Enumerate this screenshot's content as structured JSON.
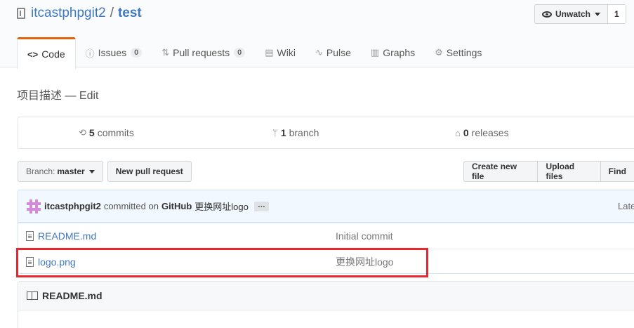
{
  "repo": {
    "owner": "itcastphpgit2",
    "separator": "/",
    "name": "test"
  },
  "watch": {
    "label": "Unwatch",
    "count": "1"
  },
  "tabs": [
    {
      "icon": "<>",
      "label": "Code"
    },
    {
      "icon": "ⓘ",
      "label": "Issues",
      "count": "0"
    },
    {
      "icon": "⇅",
      "label": "Pull requests",
      "count": "0"
    },
    {
      "icon": "▤",
      "label": "Wiki"
    },
    {
      "icon": "∿",
      "label": "Pulse"
    },
    {
      "icon": "▥",
      "label": "Graphs"
    },
    {
      "icon": "⚙",
      "label": "Settings"
    }
  ],
  "description": "项目描述 — Edit",
  "stats": {
    "commits": {
      "count": "5",
      "label": "commits"
    },
    "branches": {
      "count": "1",
      "label": "branch"
    },
    "releases": {
      "count": "0",
      "label": "releases"
    }
  },
  "toolbar": {
    "branch_prefix": "Branch:",
    "branch_name": "master",
    "new_pr": "New pull request",
    "create_file": "Create new file",
    "upload_files": "Upload files",
    "find": "Find"
  },
  "commit": {
    "author": "itcastphpgit2",
    "action": "committed on",
    "platform": "GitHub",
    "message": "更换网址logo",
    "ellipsis": "…",
    "latest": "Late"
  },
  "files": [
    {
      "name": "README.md",
      "message": "Initial commit"
    },
    {
      "name": "logo.png",
      "message": "更换网址logo"
    }
  ],
  "readme": {
    "title": "README.md"
  },
  "colors": {
    "link": "#4078c0",
    "accent_tab": "#e36209",
    "highlight": "#e8262d"
  }
}
